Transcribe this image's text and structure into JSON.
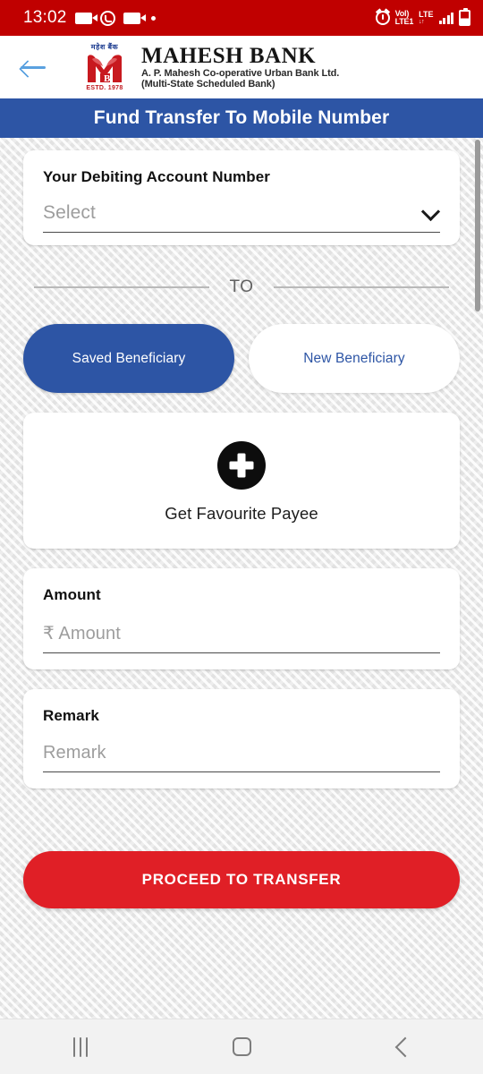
{
  "status_bar": {
    "time": "13:02",
    "left_icons": [
      "video-camera-icon",
      "whatsapp-icon",
      "video-camera-icon",
      "dot-icon"
    ],
    "alarm_icon": "alarm-icon",
    "volte_line1": "VoI)",
    "volte_line2": "LTE1",
    "lte_label": "LTE",
    "lte_arrows": "↓↑",
    "signal_icon": "signal-bars-icon",
    "battery_icon": "battery-icon",
    "background_color": "#c00000"
  },
  "header": {
    "back_icon": "back-arrow-icon",
    "back_icon_color": "#5aa1e0",
    "logo": {
      "hindi_text": "महेश  बैंक",
      "estd_text": "ESTD. 1978",
      "emblem_color": "#c01a20"
    },
    "bank_name": "MAHESH BANK",
    "bank_subtitle_line1": "A. P. Mahesh Co-operative Urban Bank Ltd.",
    "bank_subtitle_line2": "(Multi-State Scheduled Bank)"
  },
  "title_bar": {
    "title": "Fund Transfer To Mobile Number",
    "background_color": "#2d55a5"
  },
  "account_section": {
    "label": "Your Debiting Account Number",
    "placeholder": "Select",
    "value": "",
    "chevron_icon": "chevron-down-icon"
  },
  "divider": {
    "label": "TO"
  },
  "beneficiary_tabs": [
    {
      "label": "Saved Beneficiary",
      "active": true
    },
    {
      "label": "New Beneficiary",
      "active": false
    }
  ],
  "payee_section": {
    "plus_icon": "plus-circle-icon",
    "label": "Get Favourite Payee"
  },
  "amount_section": {
    "label": "Amount",
    "placeholder": "₹ Amount",
    "value": ""
  },
  "remark_section": {
    "label": "Remark",
    "placeholder": "Remark",
    "value": ""
  },
  "proceed_button": {
    "label": "PROCEED TO TRANSFER",
    "color": "#e01f26"
  },
  "nav_bar": {
    "recents_icon": "recents-icon",
    "home_icon": "home-icon",
    "back_icon": "nav-back-icon"
  }
}
